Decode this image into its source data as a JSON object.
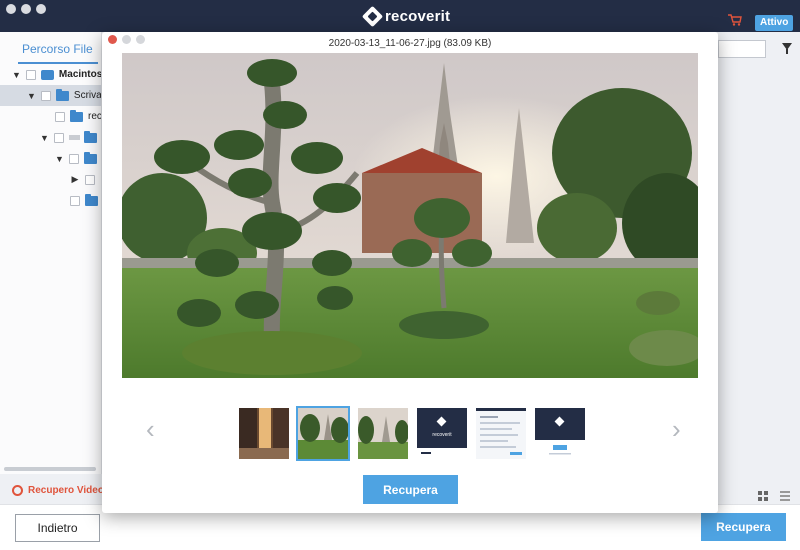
{
  "app": {
    "brand_name": "recoverit",
    "status_badge": "Attivo",
    "accent_color": "#4ea3e2",
    "titlebar_color": "#232d45"
  },
  "sidebar": {
    "tab_label": "Percorso File",
    "tree": [
      {
        "label": "Macintosh",
        "icon": "drive-icon",
        "expanded": true,
        "bold": true
      },
      {
        "label": "Scrivania",
        "icon": "folder-icon",
        "expanded": true,
        "selected": true
      },
      {
        "label": "rec",
        "icon": "folder-icon"
      },
      {
        "label": "",
        "icon": "folder-icon",
        "expanded": true,
        "blurred": true
      },
      {
        "label": "",
        "icon": "folder-icon",
        "expanded": true
      },
      {
        "label": "",
        "icon": "none",
        "expanded": false
      },
      {
        "label": "",
        "icon": "folder-icon"
      }
    ],
    "recover_video_label": "Recupero Video A"
  },
  "footer": {
    "back_label": "Indietro",
    "recover_label": "Recupera"
  },
  "preview": {
    "title": "2020-03-13_11-06-27.jpg (83.09 KB)",
    "recover_label": "Recupera",
    "thumbnail_count": 6,
    "selected_thumbnail": 2,
    "thumbnails": [
      {
        "kind": "street-photo"
      },
      {
        "kind": "temple-garden-photo"
      },
      {
        "kind": "temple-photo"
      },
      {
        "kind": "recoverit-splash",
        "logo_text": "recoverit"
      },
      {
        "kind": "settings-screenshot"
      },
      {
        "kind": "recoverit-dialog"
      }
    ]
  }
}
